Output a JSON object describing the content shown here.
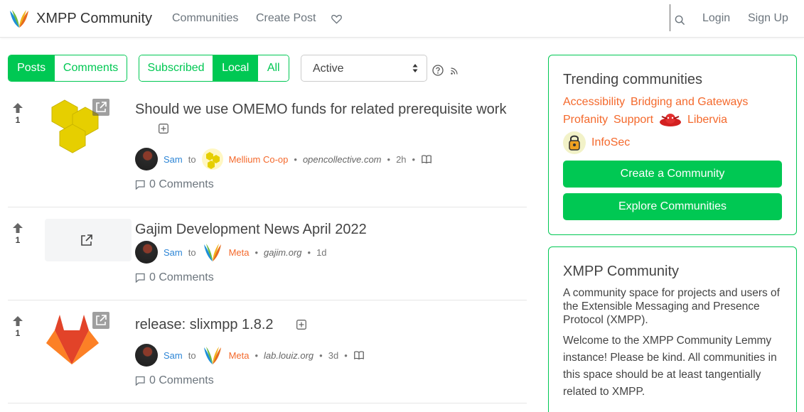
{
  "nav": {
    "title": "XMPP Community",
    "links": [
      "Communities",
      "Create Post"
    ],
    "login": "Login",
    "signup": "Sign Up",
    "icons": [
      "heart-icon",
      "search-icon"
    ]
  },
  "toolbar": {
    "view_tabs": [
      "Posts",
      "Comments"
    ],
    "listing_tabs": [
      "Subscribed",
      "Local",
      "All"
    ],
    "sort_value": "Active",
    "active_view": "Posts",
    "active_listing": "Local"
  },
  "posts": [
    {
      "score": "1",
      "title": "Should we use OMEMO funds for related prerequisite work",
      "user": "Sam",
      "to": "to",
      "community": "Mellium Co-op",
      "domain": "opencollective.com",
      "age": "2h",
      "comments": "0 Comments"
    },
    {
      "score": "1",
      "title": "Gajim Development News April 2022",
      "user": "Sam",
      "to": "to",
      "community": "Meta",
      "domain": "gajim.org",
      "age": "1d",
      "comments": "0 Comments"
    },
    {
      "score": "1",
      "title": "release: slixmpp 1.8.2",
      "user": "Sam",
      "to": "to",
      "community": "Meta",
      "domain": "lab.louiz.org",
      "age": "3d",
      "comments": "0 Comments"
    }
  ],
  "sidebar": {
    "trending_title": "Trending communities",
    "trending": [
      "Accessibility",
      "Bridging and Gateways",
      "Profanity",
      "Support",
      "Libervia",
      "InfoSec"
    ],
    "create_button": "Create a Community",
    "explore_button": "Explore Communities",
    "site_title": "XMPP Community",
    "site_description": "A community space for projects and users of the Extensible Messaging and Presence Protocol (XMPP).",
    "site_welcome": "Welcome to the XMPP Community Lemmy instance! Please be kind. All communities in this space should be at least tangentially related to XMPP."
  },
  "colors": {
    "primary": "#00c853",
    "community_link": "#f4692c",
    "user_link": "#2e86d6"
  }
}
